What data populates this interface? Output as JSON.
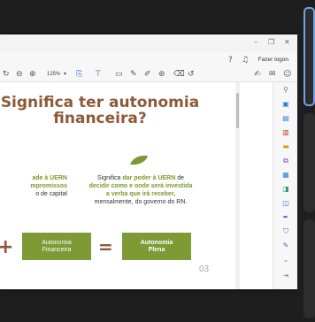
{
  "window": {
    "controls": {
      "minimize": "–",
      "restore": "❐",
      "close": "✕"
    }
  },
  "toolbar": {
    "zoom": "125%",
    "sign_in": "Fazer logon"
  },
  "slide": {
    "title_line1": "Significa ter autonomia",
    "title_line2": "financeira?",
    "left_text_line1": "ade à UERN",
    "left_text_line2": "mpromissos",
    "left_text_line3": "o de capital",
    "right_text_line1_prefix": "Significa ",
    "right_text_line1_bold": "dar poder à UERN",
    "right_text_line1_suffix": " de",
    "right_text_line2": "decidir como e onde será investida",
    "right_text_line3": "a verba que irá receber,",
    "right_text_line4": "mensalmente, do governo do RN.",
    "plus": "+",
    "box1_line1": "Autonomia",
    "box1_line2": "Financeira",
    "equals": "=",
    "box2_line1": "Autonomia",
    "box2_line2": "Plena",
    "page_number": "03"
  },
  "colors": {
    "title": "#8c5a38",
    "accent_green": "#7d9a35",
    "text_green": "#7a9a2b"
  }
}
